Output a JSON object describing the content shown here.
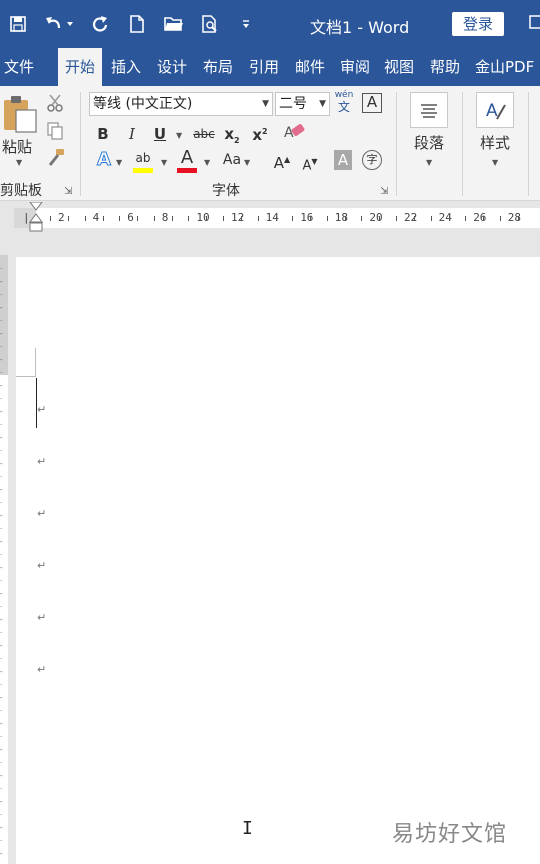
{
  "title_bar": {
    "document_title": "文档1  -  Word",
    "login_label": "登录",
    "icons": [
      "save-icon",
      "undo-icon",
      "redo-icon",
      "new-document-icon",
      "open-folder-icon",
      "print-preview-icon",
      "customize-quick-access-icon",
      "window-icon"
    ]
  },
  "menu": {
    "tabs": [
      "文件",
      "开始",
      "插入",
      "设计",
      "布局",
      "引用",
      "邮件",
      "审阅",
      "视图",
      "帮助",
      "金山PDF"
    ],
    "active_tab": "开始"
  },
  "clipboard": {
    "paste_label": "粘贴",
    "group_label": "剪贴板"
  },
  "font_group": {
    "font_name": "等线 (中文正文)",
    "font_size": "二号",
    "bold": "B",
    "italic": "I",
    "underline": "U",
    "strikethrough": "abc",
    "subscript": "x",
    "subscript_mark": "2",
    "superscript": "x",
    "superscript_mark": "2",
    "phonetic_top": "wén",
    "phonetic_bottom": "文",
    "char_border": "A",
    "text_effect": "A",
    "highlight": "ab",
    "font_color": "A",
    "change_case": "Aa",
    "grow_font": "A",
    "shrink_font": "A",
    "char_shading": "A",
    "enclose_char": "字",
    "group_label": "字体",
    "highlight_color": "#ffff00",
    "font_color_bar": "#e81123"
  },
  "paragraph_group": {
    "label": "段落"
  },
  "styles_group": {
    "label": "样式"
  },
  "ruler": {
    "left_marker": "|",
    "numbers": [
      "2",
      "4",
      "6",
      "8",
      "10",
      "12",
      "14",
      "16",
      "18",
      "20",
      "22",
      "24",
      "26",
      "28"
    ]
  },
  "document": {
    "paragraph_mark": "↵",
    "paragraph_count": 6
  },
  "watermark": "易坊好文馆",
  "colors": {
    "accent": "#2b579a"
  }
}
